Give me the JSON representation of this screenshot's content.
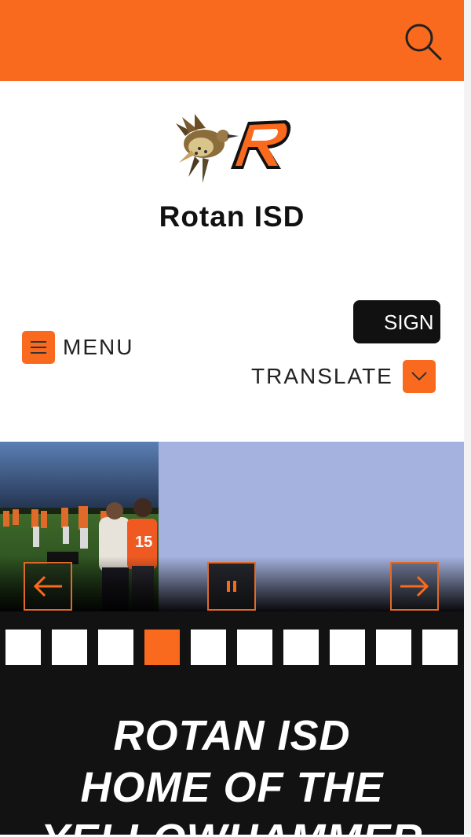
{
  "colors": {
    "accent": "#fa6a1e",
    "dark": "#121212",
    "slide_background": "#a5b2df"
  },
  "topbar": {
    "search_icon": "search-icon"
  },
  "header": {
    "logo_icon": "bird-r-logo",
    "site_title": "Rotan ISD",
    "menu_label": "MENU",
    "signin_label": "SIGN IN",
    "translate_label": "TRANSLATE"
  },
  "slideshow": {
    "prev_icon": "arrow-left-icon",
    "pause_icon": "pause-icon",
    "next_icon": "arrow-right-icon",
    "total_slides": 10,
    "active_slide": 4
  },
  "banner": {
    "lines": [
      "ROTAN ISD",
      "HOME OF THE",
      "YELLOWHAMMER"
    ]
  }
}
